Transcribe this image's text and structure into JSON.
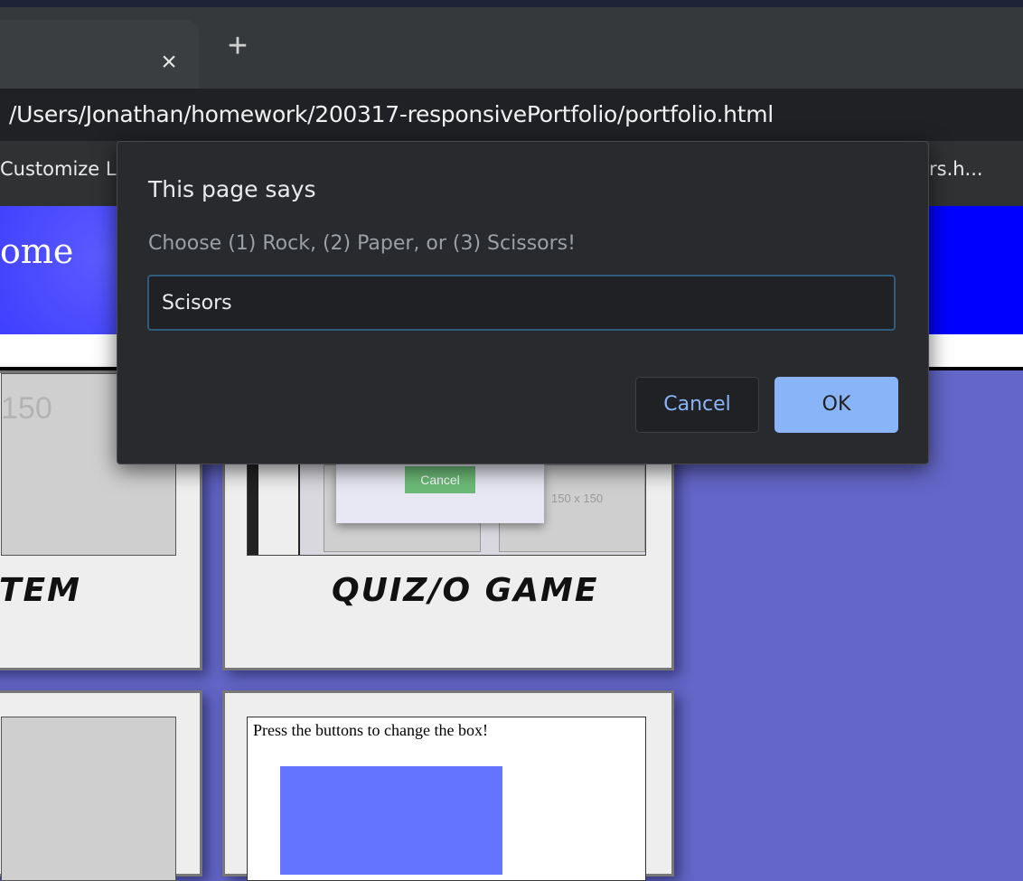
{
  "browser": {
    "tab_close_icon": "×",
    "new_tab_icon": "+",
    "url": "/Users/Jonathan/homework/200317-responsivePortfolio/portfolio.html",
    "bookmark_left": "Customize L",
    "bookmark_right": "rs.h..."
  },
  "page": {
    "header_title": "ome",
    "cards": {
      "card1_placeholder": "150",
      "card1_label": "TEM",
      "card2_label": "QUIZ/O GAME",
      "card2_shot_cancel": "Cancel",
      "card2_shot_size": "150 x 150",
      "card4_text": "Press the buttons to change the box!"
    }
  },
  "dialog": {
    "title": "This page says",
    "message": "Choose (1) Rock, (2) Paper, or (3) Scissors!",
    "input_value": "Scisors",
    "cancel_label": "Cancel",
    "ok_label": "OK"
  },
  "colors": {
    "page_bg": "#6466c8",
    "header_blue": "#0000ff",
    "dialog_bg": "#292a2d",
    "ok_button": "#8ab4f8"
  }
}
